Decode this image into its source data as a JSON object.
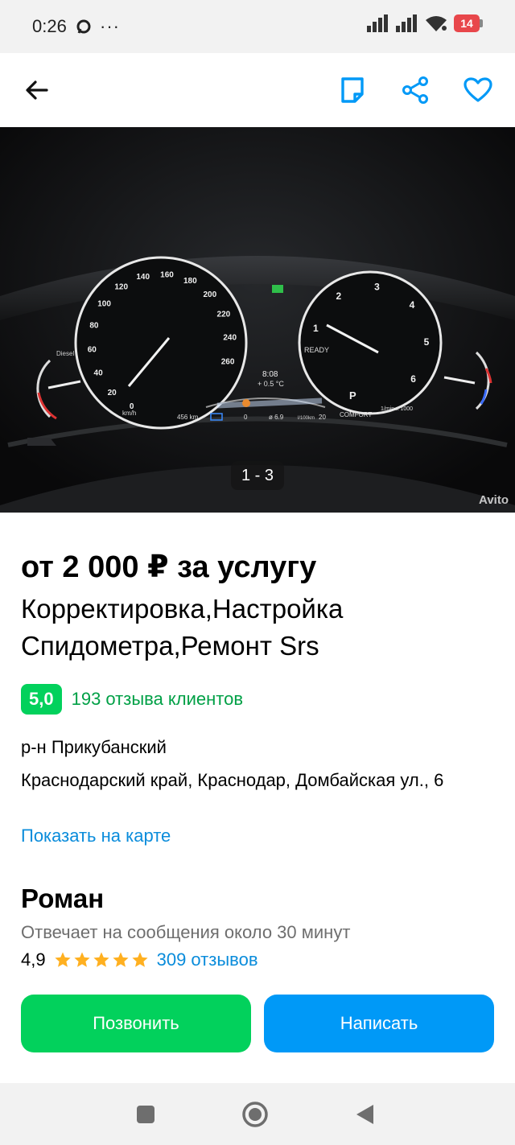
{
  "status_bar": {
    "time": "0:26",
    "more": "···",
    "battery": "14"
  },
  "app_bar": {
    "back_icon": "arrow-left-icon",
    "note_icon": "note-icon",
    "share_icon": "share-icon",
    "favorite_icon": "heart-icon",
    "accent_color": "#0099f7"
  },
  "gallery": {
    "counter": "1 - 3",
    "watermark": "Avito",
    "photo": {
      "speed_labels": [
        "0",
        "20",
        "40",
        "60",
        "80",
        "100",
        "120",
        "140",
        "160",
        "180",
        "200",
        "220",
        "240",
        "260"
      ],
      "speed_unit": "km/h",
      "rpm_labels": [
        "1",
        "2",
        "3",
        "4",
        "5",
        "6"
      ],
      "rpm_unit": "1/min x 1000",
      "ready": "READY",
      "gear": "P",
      "mode": "COMFORT",
      "clock": "8:08",
      "temperature": "+ 0.5 °C",
      "range": "456 km",
      "fuel_avg": "ø 6.9",
      "fuel_unit": "l/100km",
      "scale_min": "0",
      "scale_max": "20",
      "side_label": "Diesel"
    }
  },
  "listing": {
    "price": "от 2 000 ₽ за услугу",
    "title": "Корректировка,Настройка Спидометра,Ремонт Srs",
    "rating": "5,0",
    "reviews": "193 отзыва клиентов",
    "district": "р-н Прикубанский",
    "address": "Краснодарский край, Краснодар, Домбайская ул., 6",
    "map_link": "Показать на карте"
  },
  "seller": {
    "name": "Роман",
    "response_time": "Отвечает на сообщения около 30 минут",
    "rating": "4,9",
    "stars": 5,
    "reviews": "309 отзывов"
  },
  "actions": {
    "call": "Позвонить",
    "write": "Написать",
    "call_color": "#02d15c",
    "write_color": "#0099f7"
  },
  "nav_bar": {
    "recents_icon": "square-icon",
    "home_icon": "circle-icon",
    "back_icon": "triangle-back-icon"
  }
}
